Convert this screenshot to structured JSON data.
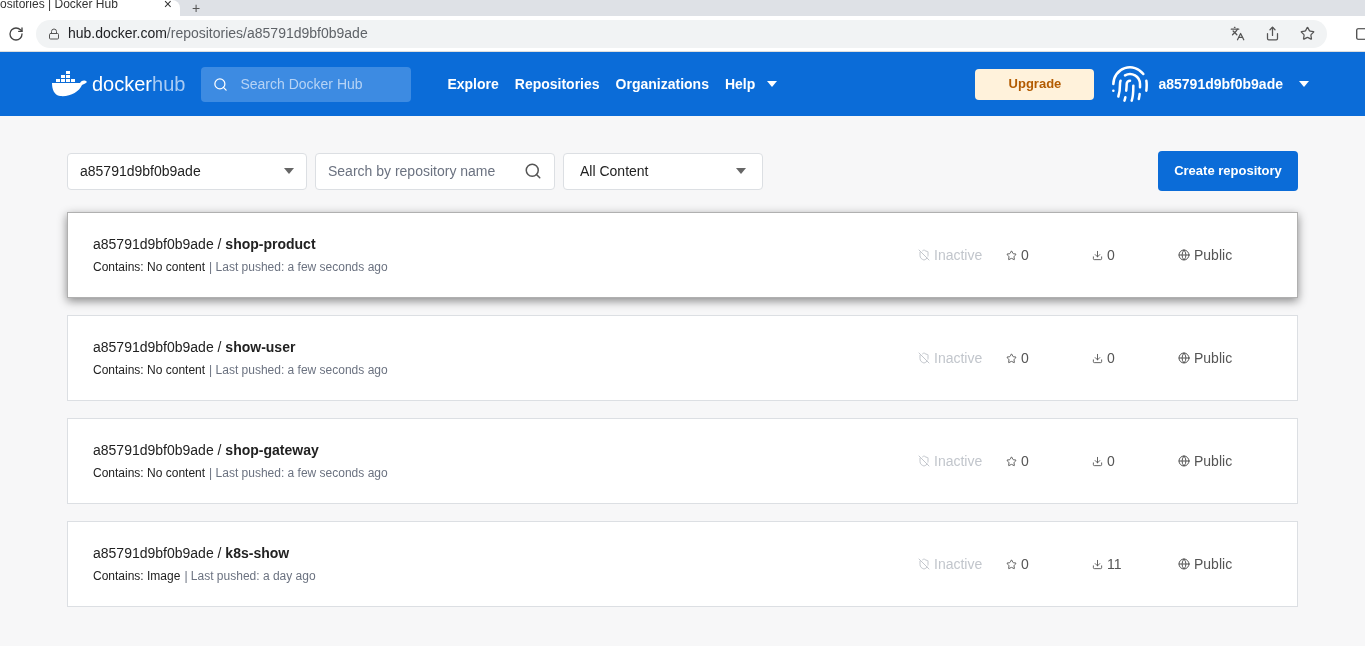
{
  "browser": {
    "tab_title": "ositories | Docker Hub",
    "tab_close": "×",
    "new_tab": "+",
    "url_host": "hub.docker.com",
    "url_path": "/repositories/a85791d9bf0b9ade"
  },
  "nav": {
    "logo_word1": "docker",
    "logo_word2": "hub",
    "search_placeholder": "Search Docker Hub",
    "links": [
      "Explore",
      "Repositories",
      "Organizations",
      "Help"
    ],
    "upgrade": "Upgrade",
    "username": "a85791d9bf0b9ade"
  },
  "filters": {
    "namespace": "a85791d9bf0b9ade",
    "search_placeholder": "Search by repository name",
    "content": "All Content",
    "create": "Create repository"
  },
  "repositories": [
    {
      "title": "a85791d9bf0b9ade / **shop-product**",
      "contains": "Contains: No content",
      "pushed": "| Last pushed: a few seconds ago",
      "status": "Inactive",
      "stars": "0",
      "pulls": "0",
      "visibility": "Public",
      "hovered": true
    },
    {
      "title": "a85791d9bf0b9ade / **show-user**",
      "contains": "Contains: No content",
      "pushed": "| Last pushed: a few seconds ago",
      "status": "Inactive",
      "stars": "0",
      "pulls": "0",
      "visibility": "Public",
      "hovered": false
    },
    {
      "title": "a85791d9bf0b9ade / **shop-gateway**",
      "contains": "Contains: No content",
      "pushed": "| Last pushed: a few seconds ago",
      "status": "Inactive",
      "stars": "0",
      "pulls": "0",
      "visibility": "Public",
      "hovered": false
    },
    {
      "title": "a85791d9bf0b9ade / **k8s-show**",
      "contains": "Contains: Image",
      "pushed": "| Last pushed: a day ago",
      "status": "Inactive",
      "stars": "0",
      "pulls": "11",
      "visibility": "Public",
      "hovered": false
    }
  ]
}
